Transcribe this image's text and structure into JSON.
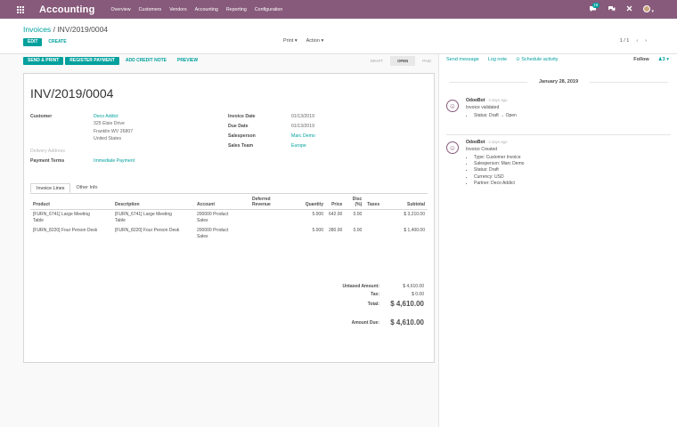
{
  "topbar": {
    "app_name": "Accounting",
    "menu": [
      "Overview",
      "Customers",
      "Vendors",
      "Accounting",
      "Reporting",
      "Configuration"
    ],
    "chat_badge": "18",
    "icons": [
      "apps-grid-icon",
      "chat-icon",
      "activity-icon",
      "close-icon",
      "user-avatar"
    ]
  },
  "control_panel": {
    "breadcrumb_parent": "Invoices",
    "breadcrumb_sep": "/",
    "breadcrumb_current": "INV/2019/0004",
    "edit_label": "EDIT",
    "create_label": "CREATE",
    "print_label": "Print",
    "action_label": "Action",
    "pager": "1 / 1"
  },
  "statusbar": {
    "send_print": "SEND & PRINT",
    "register_payment": "REGISTER PAYMENT",
    "add_credit_note": "ADD CREDIT NOTE",
    "preview": "PREVIEW",
    "stages": [
      "DRAFT",
      "OPEN",
      "PAID"
    ],
    "active_stage": "OPEN"
  },
  "invoice": {
    "number": "INV/2019/0004",
    "customer_label": "Customer",
    "customer_name": "Deco Addict",
    "address_line1": "325 Elsie Drive",
    "address_line2": "Franklin WV 26807",
    "address_line3": "United States",
    "delivery_address_label": "Delivery Address",
    "payment_terms_label": "Payment Terms",
    "payment_terms": "Immediate Payment",
    "invoice_date_label": "Invoice Date",
    "invoice_date": "01/13/2019",
    "due_date_label": "Due Date",
    "due_date": "01/13/2019",
    "salesperson_label": "Salesperson",
    "salesperson": "Marc Demo",
    "sales_team_label": "Sales Team",
    "sales_team": "Europe"
  },
  "tabs": [
    "Invoice Lines",
    "Other Info"
  ],
  "lines": {
    "headers": {
      "product": "Product",
      "description": "Description",
      "account": "Account",
      "deferred_1": "Deferred",
      "deferred_2": "Revenue",
      "quantity": "Quantity",
      "price": "Price",
      "disc_1": "Disc",
      "disc_2": "(%)",
      "taxes": "Taxes",
      "subtotal": "Subtotal"
    },
    "rows": [
      {
        "product_1": "[FURN_6741] Large Meeting",
        "product_2": "Table",
        "description_1": "[FURN_6741] Large Meeting",
        "description_2": "Table",
        "account_1": "200000 Product",
        "account_2": "Sales",
        "quantity": "5.000",
        "price": "642.00",
        "disc": "0.00",
        "subtotal": "$ 3,210.00"
      },
      {
        "product_1": "[FURN_8220] Four Person Desk",
        "product_2": "",
        "description_1": "[FURN_8220] Four Person Desk",
        "description_2": "",
        "account_1": "200000 Product",
        "account_2": "Sales",
        "quantity": "5.000",
        "price": "280.00",
        "disc": "0.00",
        "subtotal": "$ 1,400.00"
      }
    ]
  },
  "totals": {
    "untaxed_label": "Untaxed Amount:",
    "untaxed": "$ 4,610.00",
    "tax_label": "Tax:",
    "tax": "$ 0.00",
    "total_label": "Total:",
    "total": "$ 4,610.00",
    "amount_due_label": "Amount Due:",
    "amount_due": "$ 4,610.00"
  },
  "chatter": {
    "send_message": "Send message",
    "log_note": "Log note",
    "schedule_activity": "Schedule activity",
    "follow": "Follow",
    "followers_count": "3",
    "date_separator": "January 28, 2019",
    "messages": [
      {
        "author": "OdooBot",
        "ago": "- 3 days ago",
        "text": "Invoice validated",
        "tracking": [
          "Status: Draft → Open"
        ]
      },
      {
        "author": "OdooBot",
        "ago": "- 3 days ago",
        "text": "Invoice Created",
        "tracking": [
          "Type: Customer Invoice",
          "Salesperson: Marc Demo",
          "Status: Draft",
          "Currency: USD",
          "Partner: Deco Addict"
        ]
      }
    ]
  },
  "colors": {
    "brand": "#875a7b",
    "primary": "#00a09d"
  }
}
